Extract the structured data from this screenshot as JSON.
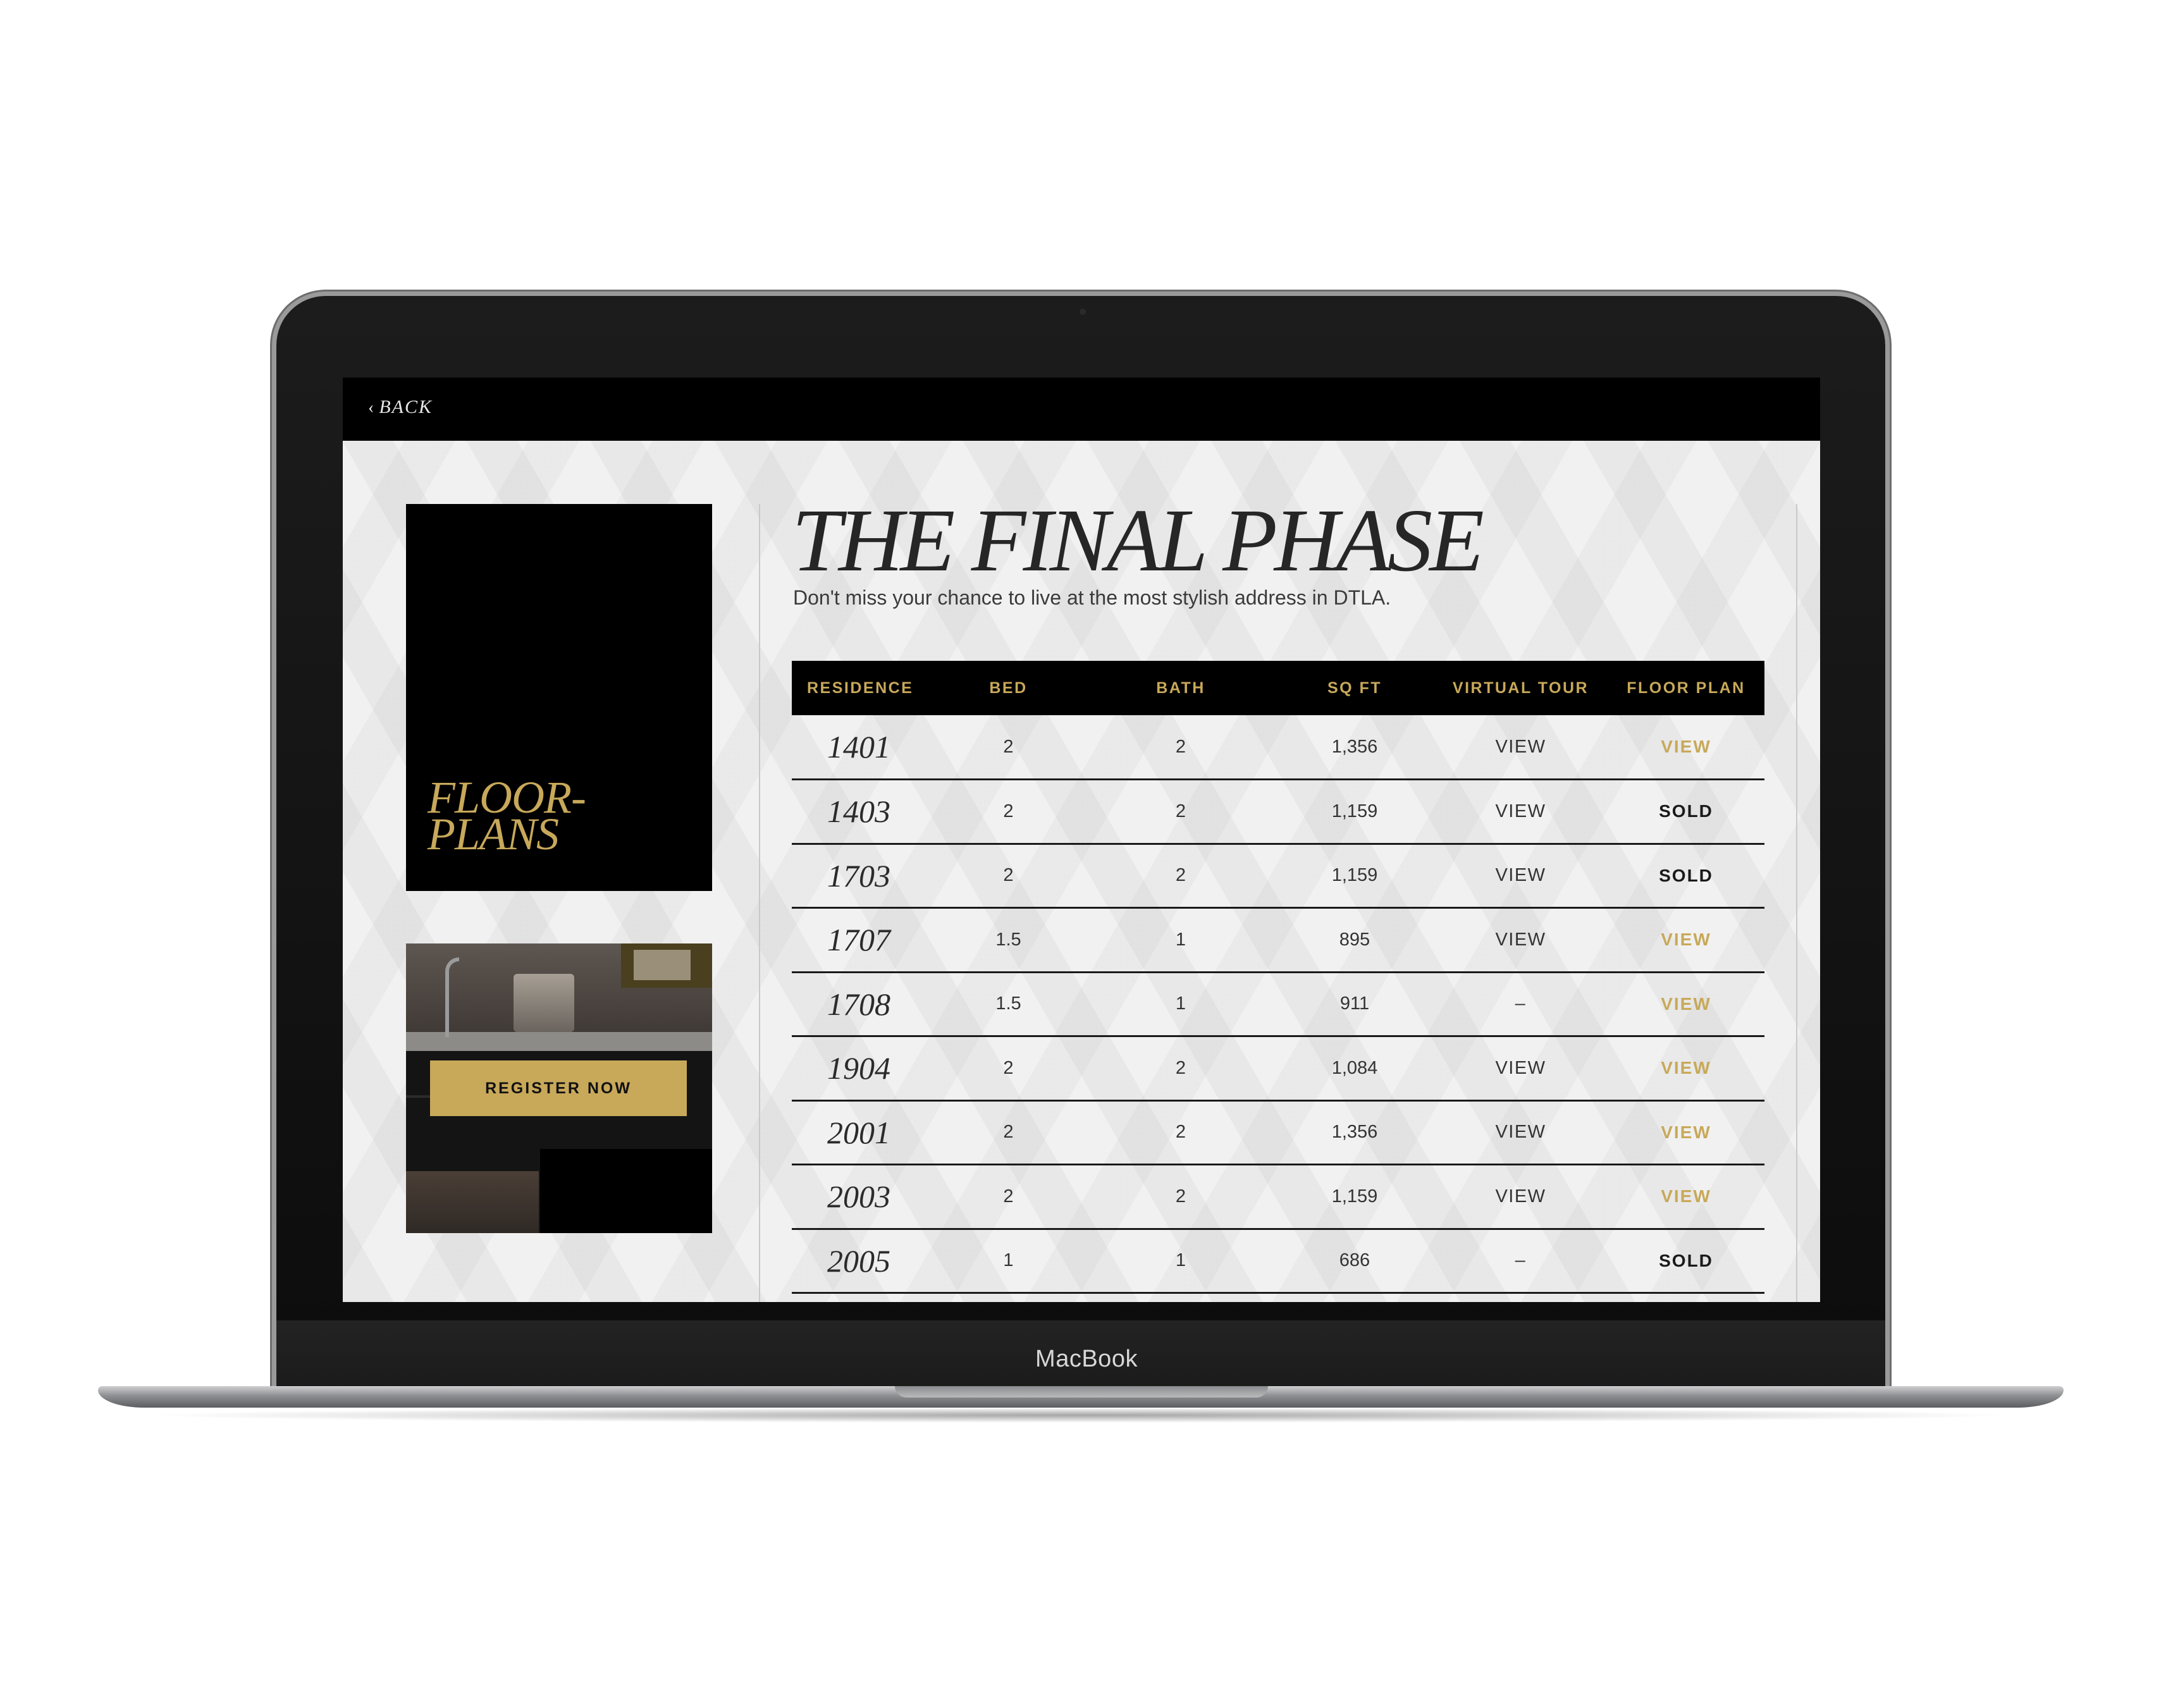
{
  "device": {
    "brand": "MacBook"
  },
  "nav": {
    "back_label": "BACK",
    "back_icon": "chevron-left-icon"
  },
  "sidebar": {
    "floorplans_title": "FLOOR-\nPLANS",
    "register_button": "REGISTER NOW"
  },
  "main": {
    "title": "THE FINAL PHASE",
    "subtitle": "Don't miss your chance to live at the most stylish address in DTLA."
  },
  "table": {
    "headers": [
      "RESIDENCE",
      "BED",
      "BATH",
      "SQ FT",
      "VIRTUAL TOUR",
      "FLOOR PLAN"
    ],
    "rows": [
      {
        "residence": "1401",
        "bed": "2",
        "bath": "2",
        "sqft": "1,356",
        "tour": "VIEW",
        "plan": "VIEW"
      },
      {
        "residence": "1403",
        "bed": "2",
        "bath": "2",
        "sqft": "1,159",
        "tour": "VIEW",
        "plan": "SOLD"
      },
      {
        "residence": "1703",
        "bed": "2",
        "bath": "2",
        "sqft": "1,159",
        "tour": "VIEW",
        "plan": "SOLD"
      },
      {
        "residence": "1707",
        "bed": "1.5",
        "bath": "1",
        "sqft": "895",
        "tour": "VIEW",
        "plan": "VIEW"
      },
      {
        "residence": "1708",
        "bed": "1.5",
        "bath": "1",
        "sqft": "911",
        "tour": "–",
        "plan": "VIEW"
      },
      {
        "residence": "1904",
        "bed": "2",
        "bath": "2",
        "sqft": "1,084",
        "tour": "VIEW",
        "plan": "VIEW"
      },
      {
        "residence": "2001",
        "bed": "2",
        "bath": "2",
        "sqft": "1,356",
        "tour": "VIEW",
        "plan": "VIEW"
      },
      {
        "residence": "2003",
        "bed": "2",
        "bath": "2",
        "sqft": "1,159",
        "tour": "VIEW",
        "plan": "VIEW"
      },
      {
        "residence": "2005",
        "bed": "1",
        "bath": "1",
        "sqft": "686",
        "tour": "–",
        "plan": "SOLD"
      }
    ]
  },
  "colors": {
    "accent_gold": "#c8a95a",
    "header_black": "#000000",
    "background": "#f1f1f1",
    "text_dark": "#2b2b2b"
  }
}
